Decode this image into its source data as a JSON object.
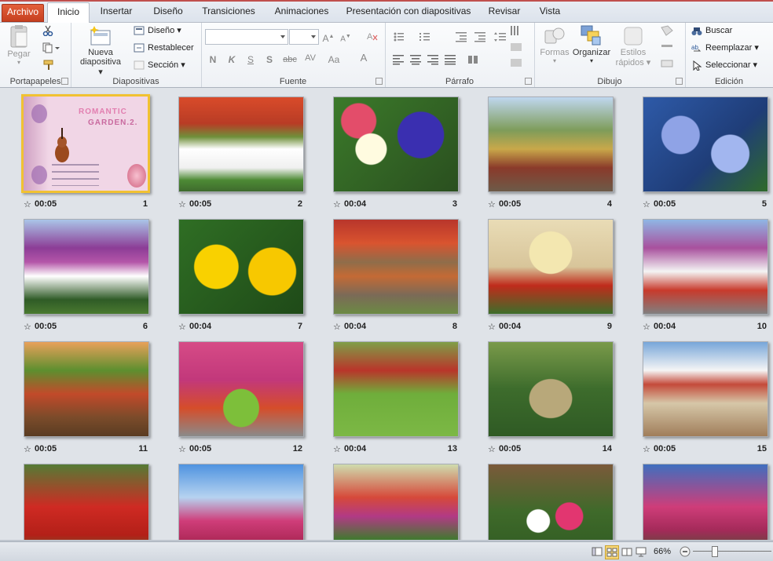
{
  "tabs": [
    {
      "label": "Archivo",
      "kind": "file"
    },
    {
      "label": "Inicio",
      "kind": "active"
    },
    {
      "label": "Insertar",
      "kind": "normal"
    },
    {
      "label": "Diseño",
      "kind": "normal"
    },
    {
      "label": "Transiciones",
      "kind": "normal"
    },
    {
      "label": "Animaciones",
      "kind": "normal"
    },
    {
      "label": "Presentación con diapositivas",
      "kind": "normal"
    },
    {
      "label": "Revisar",
      "kind": "normal"
    },
    {
      "label": "Vista",
      "kind": "normal"
    }
  ],
  "ribbon": {
    "portapapeles": {
      "label": "Portapapeles",
      "paste": "Pegar"
    },
    "diapositivas": {
      "label": "Diapositivas",
      "new_slide_1": "Nueva",
      "new_slide_2": "diapositiva",
      "layout": "Diseño",
      "reset": "Restablecer",
      "section": "Sección"
    },
    "fuente": {
      "label": "Fuente",
      "font_name": "",
      "font_size": "",
      "bold": "N",
      "italic": "K",
      "underline": "S",
      "shadow": "S",
      "strike": "abc",
      "spacing": "AV",
      "case": "Aa",
      "color": "A"
    },
    "parrafo": {
      "label": "Párrafo"
    },
    "dibujo": {
      "label": "Dibujo",
      "shapes": "Formas",
      "arrange": "Organizar",
      "quick_styles_1": "Estilos",
      "quick_styles_2": "rápidos"
    },
    "edicion": {
      "label": "Edición",
      "find": "Buscar",
      "replace": "Reemplazar",
      "select": "Seleccionar"
    }
  },
  "colors": {
    "file_tab": "#d04a27",
    "selection": "#f1c232",
    "background": "#dfe3e8"
  },
  "title_slide": {
    "title_1": "ROMANTIC",
    "title_2": "GARDEN.2."
  },
  "slides": [
    {
      "num": "1",
      "dur": "00:05",
      "selected": true,
      "scene": "title"
    },
    {
      "num": "2",
      "dur": "00:05",
      "scene": "arch"
    },
    {
      "num": "3",
      "dur": "00:04",
      "scene": "petunias"
    },
    {
      "num": "4",
      "dur": "00:05",
      "scene": "palm"
    },
    {
      "num": "5",
      "dur": "00:05",
      "scene": "blue"
    },
    {
      "num": "6",
      "dur": "00:05",
      "scene": "purplehouse"
    },
    {
      "num": "7",
      "dur": "00:04",
      "scene": "yellow"
    },
    {
      "num": "8",
      "dur": "00:04",
      "scene": "door"
    },
    {
      "num": "9",
      "dur": "00:04",
      "scene": "window"
    },
    {
      "num": "10",
      "dur": "00:04",
      "scene": "purplehouse2"
    },
    {
      "num": "11",
      "dur": "00:05",
      "scene": "cart"
    },
    {
      "num": "12",
      "dur": "00:05",
      "scene": "barrel"
    },
    {
      "num": "13",
      "dur": "00:04",
      "scene": "lawn"
    },
    {
      "num": "14",
      "dur": "00:05",
      "scene": "stump"
    },
    {
      "num": "15",
      "dur": "00:05",
      "scene": "stairs"
    },
    {
      "num": "",
      "dur": "",
      "scene": "redcart"
    },
    {
      "num": "",
      "dur": "",
      "scene": "sky"
    },
    {
      "num": "",
      "dur": "",
      "scene": "garden"
    },
    {
      "num": "",
      "dur": "",
      "scene": "cyclamen"
    },
    {
      "num": "",
      "dur": "",
      "scene": "bougain"
    }
  ],
  "status": {
    "zoom": "66%"
  }
}
